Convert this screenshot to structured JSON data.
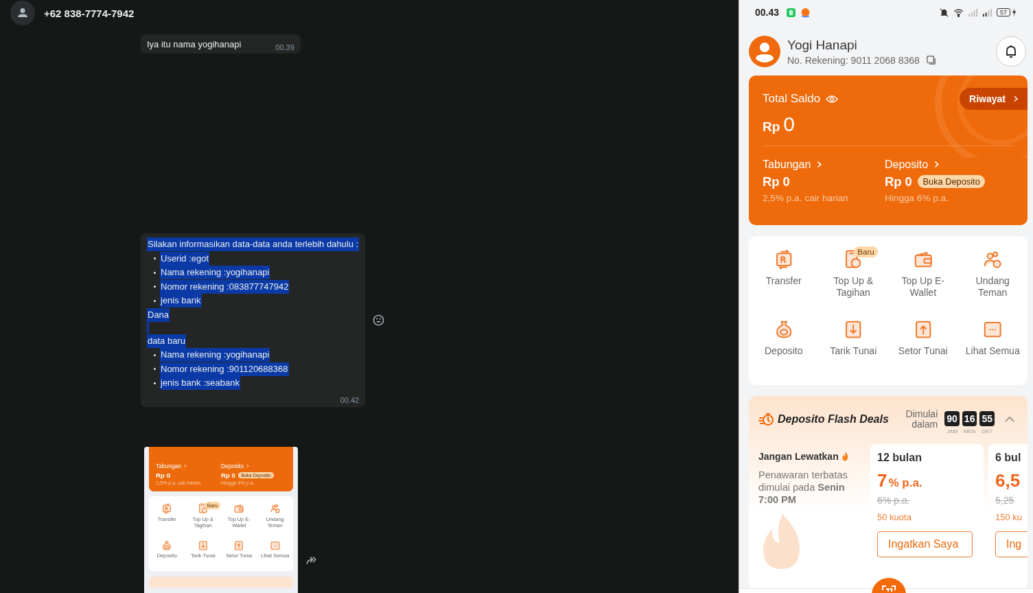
{
  "chat": {
    "contact": "+62 838-7774-7942",
    "messages": [
      {
        "kind": "text",
        "selected": false,
        "time": "00.39",
        "lines": [
          {
            "kind": "line",
            "text": "Iya itu nama yogihanapi"
          }
        ]
      },
      {
        "kind": "text",
        "selected": true,
        "time": "00.42",
        "lines": [
          {
            "kind": "line",
            "text": "Silakan informasikan data-data anda terlebih dahulu :"
          },
          {
            "kind": "bullet",
            "text": "Userid :egot"
          },
          {
            "kind": "bullet",
            "text": "Nama rekening :yogihanapi"
          },
          {
            "kind": "bullet",
            "text": "Nomor rekening :083877747942"
          },
          {
            "kind": "bullet",
            "text": "jenis bank"
          },
          {
            "kind": "line",
            "text": "Dana"
          },
          {
            "kind": "gap"
          },
          {
            "kind": "line",
            "text": "data baru"
          },
          {
            "kind": "bullet",
            "text": "Nama rekening :yogihanapi"
          },
          {
            "kind": "bullet",
            "text": "Nomor rekening :901120688368"
          },
          {
            "kind": "bullet",
            "text": "jenis bank :seabank"
          }
        ]
      },
      {
        "kind": "image",
        "selected": false,
        "screenshot": {
          "accounts": [
            {
              "label": "Tabungan",
              "amount": "Rp 0",
              "note": "2,5% p.a. cair harian"
            },
            {
              "label": "Deposito",
              "amount": "Rp 0",
              "badge": "Buka Deposito",
              "note": "Hingga 6% p.a."
            }
          ],
          "menu": [
            {
              "label": "Transfer"
            },
            {
              "label": "Top Up & Tagihan",
              "badge": "Baru"
            },
            {
              "label": "Top Up E-Wallet"
            },
            {
              "label": "Undang Teman"
            },
            {
              "label": "Deposito"
            },
            {
              "label": "Tarik Tunai"
            },
            {
              "label": "Setor Tunai"
            },
            {
              "label": "Lihat Semua"
            }
          ]
        }
      }
    ]
  },
  "phone": {
    "status": {
      "time": "00.43",
      "battery": "57"
    },
    "profile": {
      "name": "Yogi Hanapi",
      "account": "No. Rekening: 9011 2068 8368"
    },
    "balance": {
      "label": "Total Saldo",
      "history": "Riwayat",
      "currency": "Rp",
      "amount": "0"
    },
    "accounts": [
      {
        "label": "Tabungan",
        "amount": "Rp 0",
        "note": "2,5% p.a. cair harian"
      },
      {
        "label": "Deposito",
        "amount": "Rp 0",
        "badge": "Buka Deposito",
        "note": "Hingga 6% p.a."
      }
    ],
    "menu": [
      {
        "label": "Transfer"
      },
      {
        "label": "Top Up & Tagihan",
        "badge": "Baru"
      },
      {
        "label": "Top Up E-Wallet"
      },
      {
        "label": "Undang Teman"
      },
      {
        "label": "Deposito"
      },
      {
        "label": "Tarik Tunai"
      },
      {
        "label": "Setor Tunai"
      },
      {
        "label": "Lihat Semua"
      }
    ],
    "flash": {
      "title": "Deposito Flash Deals",
      "starts": "Dimulai dalam",
      "countdown": [
        {
          "value": "90",
          "unit": "JAM"
        },
        {
          "value": "16",
          "unit": "MEN"
        },
        {
          "value": "55",
          "unit": "DET"
        }
      ],
      "headline": "Jangan Lewatkan",
      "text": "Penawaran terbatas dimulai pada **Senin 7:00 PM**",
      "deals": [
        {
          "term": "12 bulan",
          "rate": "7",
          "unit": "% p.a.",
          "old": "6% p.a.",
          "quota": "50 kuota",
          "button": "Ingatkan Saya"
        },
        {
          "term": "6 bul",
          "rate": "6,5",
          "old": "5,25",
          "quota": "150 ku",
          "button": "Ing"
        }
      ]
    }
  }
}
